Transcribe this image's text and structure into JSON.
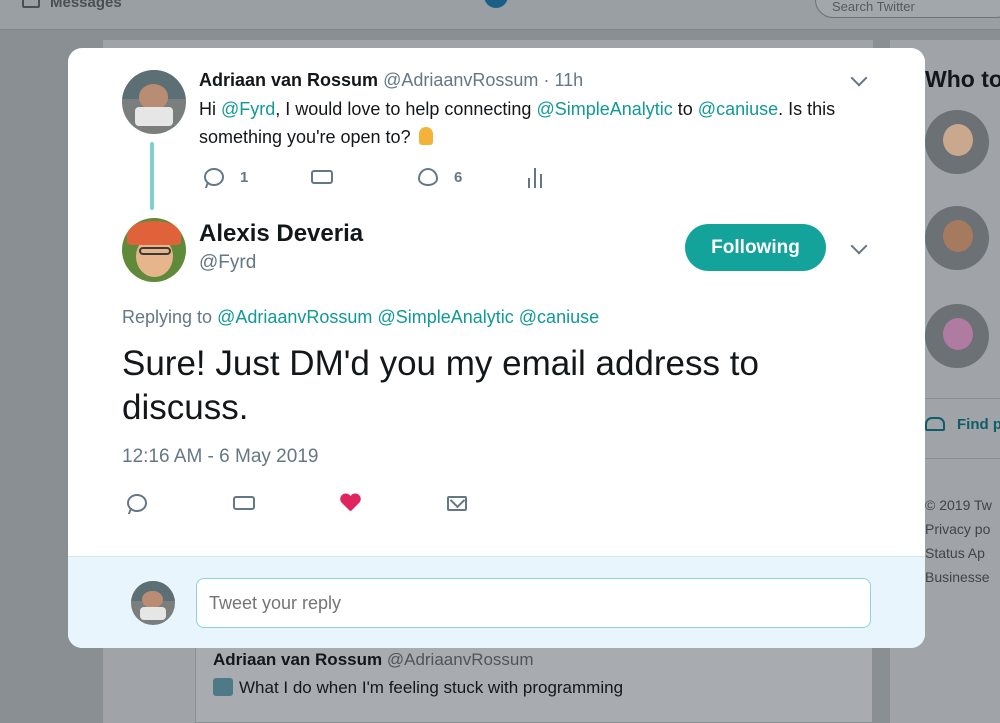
{
  "background": {
    "topbar": {
      "messages_label": "Messages",
      "search_placeholder": "Search Twitter"
    },
    "sidebar": {
      "title": "Who to",
      "find_link": "Find p",
      "footer": [
        "© 2019 Tw",
        "Privacy po",
        "Status Ap",
        "Businesse"
      ]
    },
    "feed_tweet": {
      "name": "Adriaan van Rossum",
      "handle": "@AdriaanvRossum",
      "text": "What I do when I'm feeling stuck with programming"
    }
  },
  "modal": {
    "parent_tweet": {
      "name": "Adriaan van Rossum",
      "handle": "@AdriaanvRossum",
      "separator": "·",
      "time": "11h",
      "text_parts": {
        "p1": "Hi ",
        "m1": "@Fyrd",
        "p2": ", I would love to help connecting ",
        "m2": "@SimpleAnalytic",
        "p3": " to ",
        "m3": "@caniuse",
        "p4": ". Is this something you're open to? "
      },
      "reply_count": "1",
      "like_count": "6"
    },
    "main_tweet": {
      "name": "Alexis Deveria",
      "handle": "@Fyrd",
      "follow_label": "Following",
      "replying_prefix": "Replying to",
      "replying_to": [
        "@AdriaanvRossum",
        "@SimpleAnalytic",
        "@caniuse"
      ],
      "text": "Sure! Just DM'd you my email address to discuss.",
      "timestamp": "12:16 AM - 6 May 2019"
    },
    "reply_box": {
      "placeholder": "Tweet your reply"
    }
  },
  "colors": {
    "accent": "#109a96",
    "button": "#14a39b",
    "like": "#e0245e",
    "muted": "#657786"
  }
}
